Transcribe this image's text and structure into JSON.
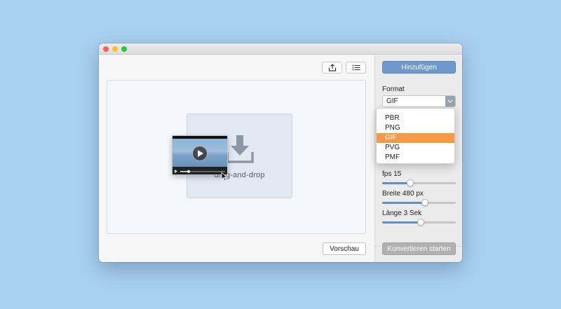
{
  "toolbar": {
    "share_icon": "share-icon",
    "list_icon": "list-icon"
  },
  "dropzone": {
    "label": "drag-and-drop",
    "download_icon": "download-arrow-icon"
  },
  "preview_button": {
    "label": "Vorschau"
  },
  "sidebar": {
    "add_button": {
      "label": "Hinzufügen"
    },
    "format": {
      "label": "Format",
      "selected": "GIF",
      "options": [
        "PBR",
        "PNG",
        "GIF",
        "PVG",
        "PMF"
      ],
      "highlighted_index": 2
    },
    "sliders": [
      {
        "label": "fps 15",
        "value": 0.38
      },
      {
        "label": "Breite 480 px",
        "value": 0.58
      },
      {
        "label": "Länge 3 Sek",
        "value": 0.52
      }
    ],
    "start_button": {
      "label": "Konvertieren starten"
    }
  },
  "colors": {
    "accent": "#6f98cf",
    "highlight": "#f49a45",
    "slider_fill": "#5f8fd0",
    "disabled": "#b1b1b1"
  }
}
